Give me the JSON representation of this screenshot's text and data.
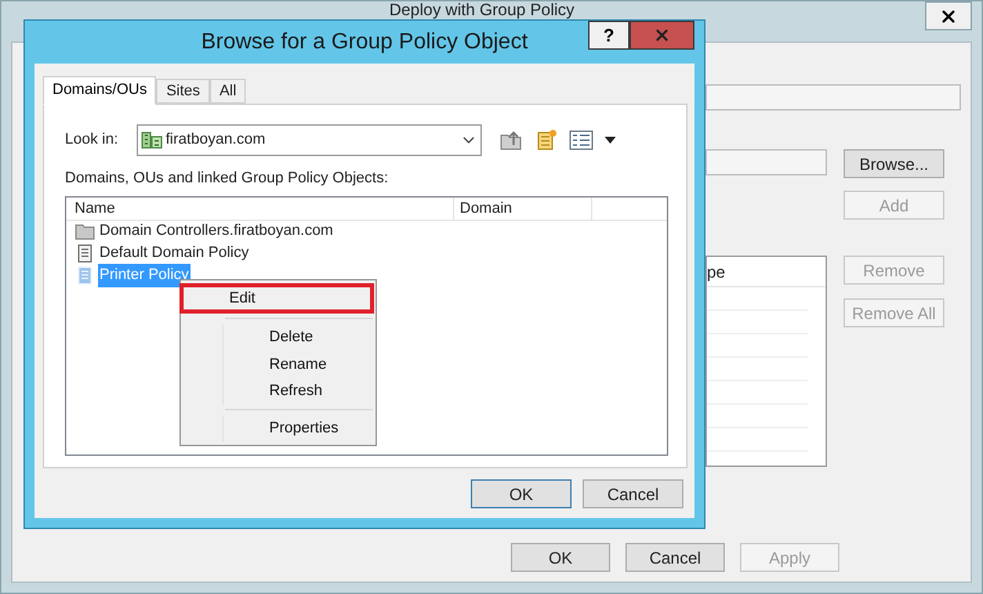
{
  "background_window": {
    "title": "Deploy with Group Policy",
    "column_header": "pe",
    "side_buttons": [
      {
        "label": "Browse...",
        "disabled": false
      },
      {
        "label": "Add",
        "disabled": true
      },
      {
        "label": "Remove",
        "disabled": true
      },
      {
        "label": "Remove All",
        "disabled": true
      }
    ],
    "footer_buttons": [
      {
        "label": "OK",
        "disabled": false
      },
      {
        "label": "Cancel",
        "disabled": false
      },
      {
        "label": "Apply",
        "disabled": true
      }
    ]
  },
  "dialog": {
    "title": "Browse for a Group Policy Object",
    "help": "?",
    "tabs": [
      {
        "label": "Domains/OUs",
        "selected": true
      },
      {
        "label": "Sites",
        "selected": false
      },
      {
        "label": "All",
        "selected": false
      }
    ],
    "look_in": {
      "label": "Look in:",
      "value": "firatboyan.com"
    },
    "list_label": "Domains, OUs and linked Group Policy Objects:",
    "columns": [
      "Name",
      "Domain"
    ],
    "items": [
      {
        "kind": "ou",
        "name": "Domain Controllers.firatboyan.com",
        "selected": false
      },
      {
        "kind": "gpo",
        "name": "Default Domain Policy",
        "selected": false
      },
      {
        "kind": "gpo",
        "name": "Printer Policy",
        "selected": true
      }
    ],
    "buttons": [
      {
        "label": "OK",
        "default": true
      },
      {
        "label": "Cancel",
        "default": false
      }
    ]
  },
  "context_menu": {
    "items": [
      {
        "kind": "item",
        "label": "Edit",
        "highlighted": true
      },
      {
        "kind": "separator"
      },
      {
        "kind": "item",
        "label": "Delete",
        "highlighted": false
      },
      {
        "kind": "item",
        "label": "Rename",
        "highlighted": false
      },
      {
        "kind": "item",
        "label": "Refresh",
        "highlighted": false
      },
      {
        "kind": "separator"
      },
      {
        "kind": "item",
        "label": "Properties",
        "highlighted": false
      }
    ]
  }
}
